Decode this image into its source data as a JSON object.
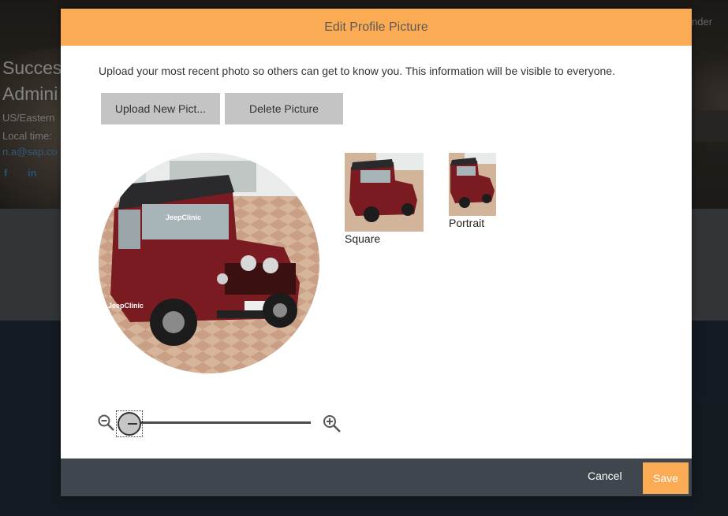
{
  "background": {
    "name_line1": "Succes",
    "name_line2": "Admini",
    "timezone": "US/Eastern",
    "local_time_label": "Local time:",
    "email": "n.a@sap.co",
    "social": [
      "f",
      "in"
    ],
    "right_text": "nder"
  },
  "modal": {
    "title": "Edit Profile Picture",
    "intro": "Upload your most recent photo so others can get to know you. This information will be visible to everyone.",
    "upload_label": "Upload New Pict...",
    "delete_label": "Delete Picture",
    "preview_square_label": "Square",
    "preview_portrait_label": "Portrait",
    "photo_watermark": "JeepClinic",
    "zoom_level": 0,
    "cancel_label": "Cancel",
    "save_label": "Save"
  },
  "colors": {
    "accent": "#fcab55",
    "footer": "#3f464e",
    "button_gray": "#c4c4c4",
    "link": "#4a8bb8"
  },
  "icons": {
    "zoom_out": "zoom-out-icon",
    "zoom_in": "zoom-in-icon"
  }
}
